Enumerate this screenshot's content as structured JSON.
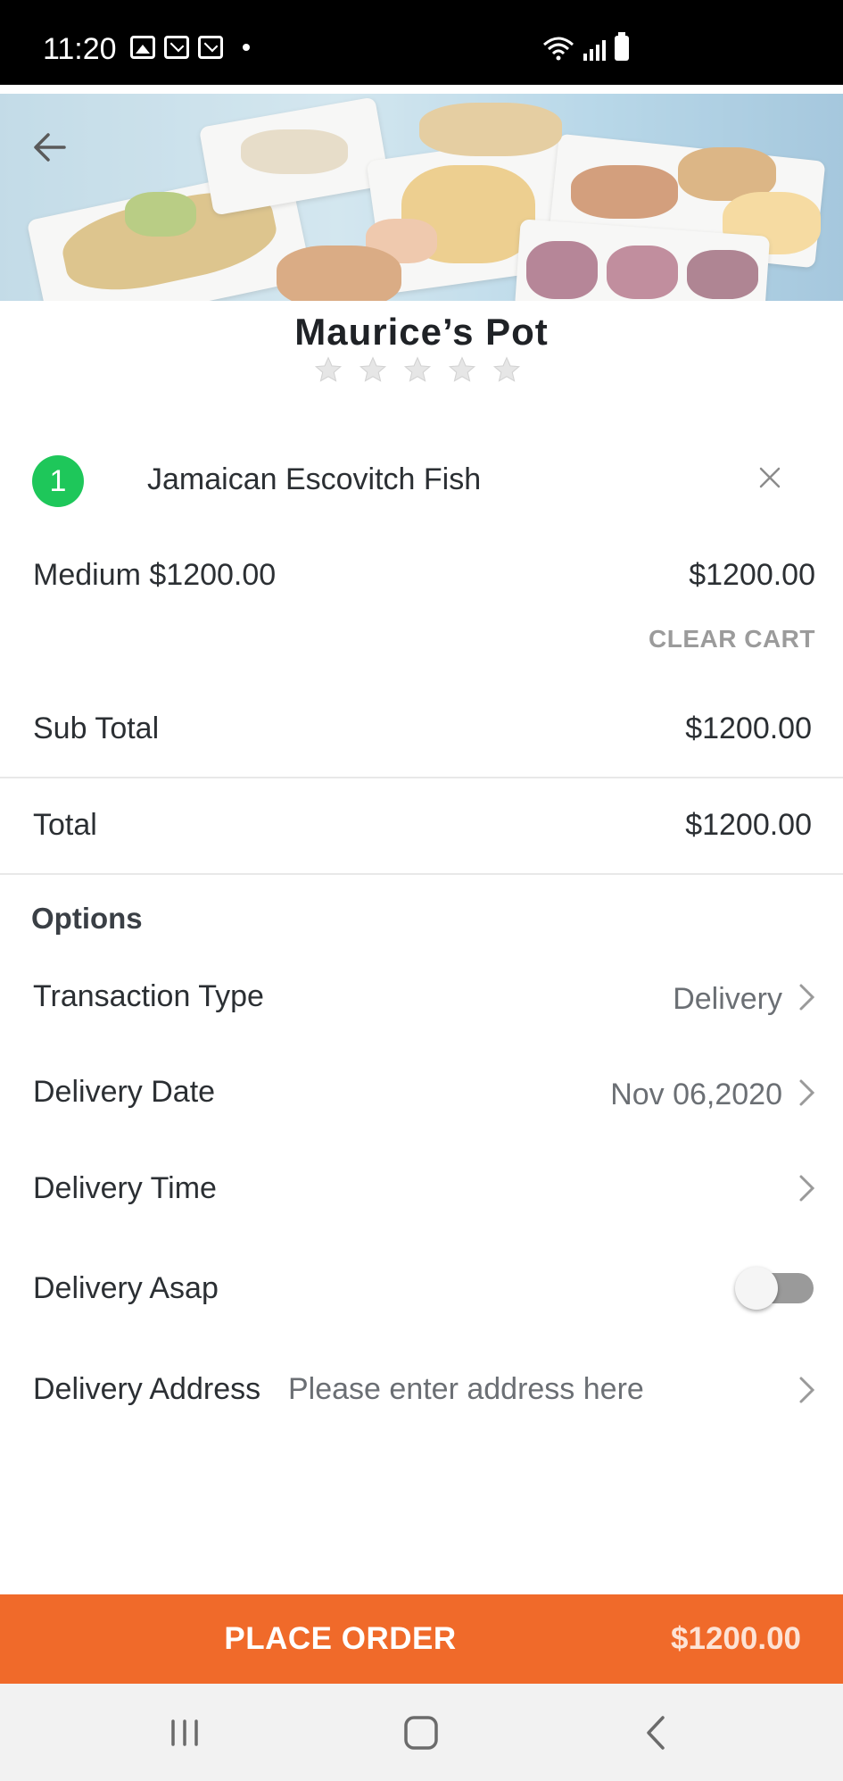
{
  "status_bar": {
    "time": "11:20",
    "left_icons": [
      "image-icon",
      "mail-icon",
      "gmail-icon",
      "dot-icon"
    ],
    "right_icons": [
      "wifi-icon",
      "signal-icon",
      "battery-icon"
    ]
  },
  "restaurant": {
    "name": "Maurice’s Pot",
    "rating_stars": 5,
    "rating_filled": 0
  },
  "cart": {
    "item_quantity": "1",
    "item_name": "Jamaican Escovitch Fish",
    "variant_label": "Medium $1200.00",
    "variant_price": "$1200.00",
    "clear_cart_label": "CLEAR CART"
  },
  "totals": {
    "subtotal_label": "Sub Total",
    "subtotal_value": "$1200.00",
    "total_label": "Total",
    "total_value": "$1200.00"
  },
  "options": {
    "title": "Options",
    "transaction_type_label": "Transaction Type",
    "transaction_type_value": "Delivery",
    "delivery_date_label": "Delivery Date",
    "delivery_date_value": "Nov 06,2020",
    "delivery_time_label": "Delivery Time",
    "delivery_asap_label": "Delivery Asap",
    "delivery_asap_on": false,
    "delivery_address_label": "Delivery Address",
    "delivery_address_placeholder": "Please enter address here"
  },
  "place_order": {
    "label": "PLACE ORDER",
    "total": "$1200.00"
  },
  "colors": {
    "accent": "#f06a2a",
    "badge": "#1ec75a",
    "star_empty": "#e0e0e0"
  }
}
